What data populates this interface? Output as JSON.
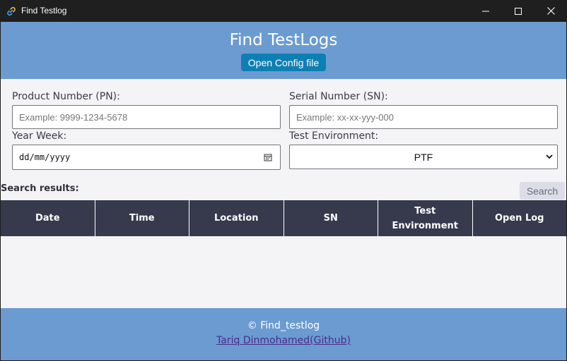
{
  "window": {
    "title": "Find Testlog",
    "icon": "app-link-icon",
    "controls": [
      "minimize-icon",
      "maximize-icon",
      "close-icon"
    ]
  },
  "header": {
    "title": "Find TestLogs",
    "config_button": "Open Config file",
    "background": "#6b9bd1",
    "button_color": "#0e7fb3"
  },
  "form": {
    "pn_label": "Product Number (PN):",
    "pn_placeholder": "Example: 9999-1234-5678",
    "sn_label": "Serial Number (SN):",
    "sn_placeholder": "Example: xx-xx-yyy-000",
    "yw_label": "Year Week:",
    "yw_value": "dd/mm/yyyy",
    "env_label": "Test Environment:",
    "env_value": "PTF"
  },
  "results": {
    "label": "Search results:",
    "search_button": "Search",
    "columns": [
      "Date",
      "Time",
      "Location",
      "SN",
      "Test Environment",
      "Open Log"
    ],
    "rows": [],
    "header_color": "#373a4d"
  },
  "footer": {
    "copyright": "© Find_testlog",
    "link": "Tariq Dinmohamed(Github)"
  }
}
